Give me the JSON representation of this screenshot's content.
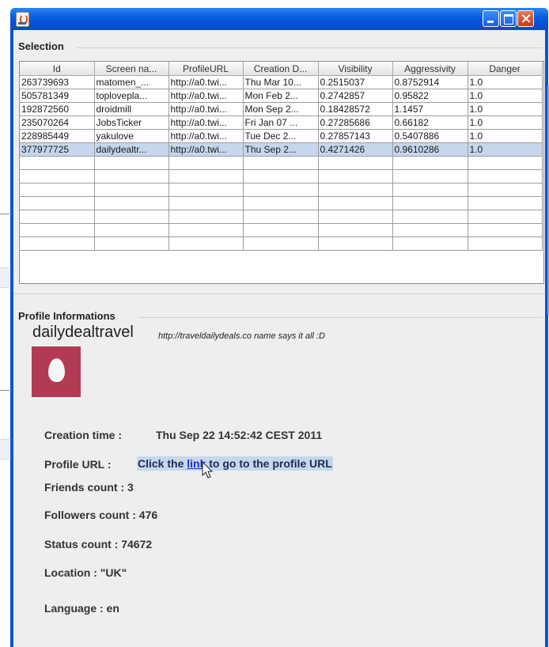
{
  "selection": {
    "title": "Selection",
    "columns": [
      "Id",
      "Screen na...",
      "ProfileURL",
      "Creation D...",
      "Visibility",
      "Aggressivity",
      "Danger"
    ],
    "rows": [
      [
        "263739693",
        "matomen_...",
        "http://a0.twi...",
        "Thu Mar 10...",
        "0.2515037",
        "0.8752914",
        "1.0"
      ],
      [
        "505781349",
        "toploveplа...",
        "http://a0.twi...",
        "Mon Feb 2...",
        "0.2742857",
        "0.95822",
        "1.0"
      ],
      [
        "192872560",
        "droidmill",
        "http://a0.twi...",
        "Mon Sep 2...",
        "0.18428572",
        "1.1457",
        "1.0"
      ],
      [
        "235070264",
        "JobsTicker",
        "http://a0.twi...",
        "Fri Jan 07 ...",
        "0.27285686",
        "0.66182",
        "1.0"
      ],
      [
        "228985449",
        "yakulove",
        "http://a0.twi...",
        "Tue Dec 2...",
        "0.27857143",
        "0.5407886",
        "1.0"
      ],
      [
        "377977725",
        "dailydealtr...",
        "http://a0.twi...",
        "Thu Sep 2...",
        "0.4271426",
        "0.9610286",
        "1.0"
      ]
    ],
    "selected_row_index": 5,
    "empty_rows": 7
  },
  "profile": {
    "title": "Profile Informations",
    "name": "dailydealtravel",
    "description": "http://traveldailydeals.co name says it all :D",
    "avatar_color": "#b23a52",
    "creation_label": "Creation time :",
    "creation_value": "Thu Sep 22 14:52:42 CEST 2011",
    "url_label": "Profile URL :",
    "url_before": "Click the ",
    "url_link": "link",
    "url_after": " to go to the profile URL",
    "friends": "Friends count : 3",
    "followers": "Followers count : 476",
    "status": "Status count :  74672",
    "location": "Location :  \"UK\"",
    "language": "Language : en"
  },
  "colors": {
    "titlebar": "#0a5ee0",
    "selection_highlight": "#c6d7ec",
    "panel_bg": "#eeeeee"
  }
}
